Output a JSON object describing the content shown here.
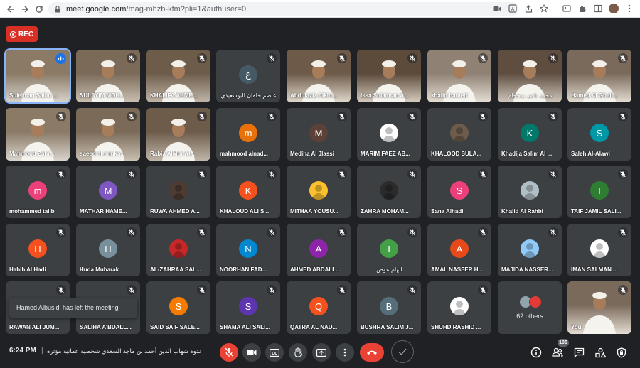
{
  "browser": {
    "url_host": "meet.google.com",
    "url_path": "/mag-mhzb-kfm?pli=1&authuser=0"
  },
  "rec_label": "REC",
  "tiles": [
    {
      "name": "Suleiman Salim ...",
      "kind": "video",
      "status": "speaking"
    },
    {
      "name": "SULAYIM MOH...",
      "kind": "video",
      "status": "muted"
    },
    {
      "name": "KHALIFA AHME...",
      "kind": "video",
      "status": "muted"
    },
    {
      "name": "عاصم خلفان البوسعيدي",
      "kind": "avatar",
      "initial": "ع",
      "color": "#455a64",
      "status": "muted"
    },
    {
      "name": "Abdulaziz Alkin...",
      "kind": "video",
      "status": "muted"
    },
    {
      "name": "Issa Sulaiman A...",
      "kind": "video",
      "status": "muted"
    },
    {
      "name": "khalid hamed",
      "kind": "video",
      "status": "muted"
    },
    {
      "name": "محمد ناصر بوحجام",
      "kind": "video",
      "status": "muted"
    },
    {
      "name": "Hamed Al Gheil...",
      "kind": "video",
      "status": "muted"
    },
    {
      "name": "Mahmood Zahr...",
      "kind": "video",
      "status": "muted"
    },
    {
      "name": "saeed al-shuka...",
      "kind": "video",
      "status": "muted"
    },
    {
      "name": "Rabia AlMur Al...",
      "kind": "video",
      "status": "muted"
    },
    {
      "name": "mahmood alnad...",
      "kind": "avatar",
      "initial": "m",
      "color": "#e8710a",
      "status": "muted"
    },
    {
      "name": "Mediha Al Jlassi",
      "kind": "avatar",
      "initial": "M",
      "color": "#5d4037",
      "status": "muted"
    },
    {
      "name": "MARIM FAEZ AB...",
      "kind": "photo",
      "color": "#ffffff",
      "status": "muted"
    },
    {
      "name": "KHALOOD SULA...",
      "kind": "photo",
      "color": "#6d5b4b",
      "status": "muted"
    },
    {
      "name": "Khadija Salim Al ...",
      "kind": "avatar",
      "initial": "K",
      "color": "#00796b",
      "status": "muted"
    },
    {
      "name": "Saleh Al-Alawi",
      "kind": "avatar",
      "initial": "S",
      "color": "#0097a7",
      "status": "muted"
    },
    {
      "name": "mohammed talib",
      "kind": "avatar",
      "initial": "m",
      "color": "#ec407a",
      "status": "muted"
    },
    {
      "name": "MATHAR HAME...",
      "kind": "avatar",
      "initial": "M",
      "color": "#7e57c2",
      "status": "muted"
    },
    {
      "name": "RUWA AHMED A...",
      "kind": "photo",
      "color": "#4e3b32",
      "status": "muted"
    },
    {
      "name": "KHALOUD ALI S...",
      "kind": "avatar",
      "initial": "K",
      "color": "#f4511e",
      "status": "muted"
    },
    {
      "name": "MITHAA YOUSU...",
      "kind": "photo",
      "color": "#fbc02d",
      "status": "muted"
    },
    {
      "name": "ZAHRA MOHAM...",
      "kind": "photo",
      "color": "#2b2b2b",
      "status": "muted"
    },
    {
      "name": "Sana Alhadi",
      "kind": "avatar",
      "initial": "S",
      "color": "#ec407a",
      "status": "muted"
    },
    {
      "name": "Khalid Al Rahbi",
      "kind": "photo",
      "color": "#b0bec5",
      "status": "muted"
    },
    {
      "name": "TAIF JAMIL SALI...",
      "kind": "avatar",
      "initial": "T",
      "color": "#2e7d32",
      "status": "muted"
    },
    {
      "name": "Habib Al Hadi",
      "kind": "avatar",
      "initial": "H",
      "color": "#f4511e",
      "status": "muted"
    },
    {
      "name": "Huda Mubarak",
      "kind": "avatar",
      "initial": "H",
      "color": "#78909c",
      "status": "muted"
    },
    {
      "name": "AL-ZAHRAA SAL...",
      "kind": "photo",
      "color": "#c62828",
      "status": "muted"
    },
    {
      "name": "NOORHAN FAD...",
      "kind": "avatar",
      "initial": "N",
      "color": "#0288d1",
      "status": "muted"
    },
    {
      "name": "AHMED ABDALL...",
      "kind": "avatar",
      "initial": "A",
      "color": "#8e24aa",
      "status": "muted"
    },
    {
      "name": "الهام عوض",
      "kind": "avatar",
      "initial": "I",
      "color": "#43a047",
      "status": "muted"
    },
    {
      "name": "AMAL NASSER H...",
      "kind": "avatar",
      "initial": "A",
      "color": "#e64a19",
      "status": "muted"
    },
    {
      "name": "MAJIDA NASSER...",
      "kind": "photo",
      "color": "#90caf9",
      "status": "muted"
    },
    {
      "name": "IMAN SALMAN ...",
      "kind": "photo",
      "color": "#ffffff",
      "status": "muted"
    },
    {
      "name": "RAWAN ALI JUM...",
      "kind": "avatar",
      "initial": "",
      "color": "#3c4043",
      "status": "muted"
    },
    {
      "name": "SALIHA A'BDALL...",
      "kind": "avatar",
      "initial": "",
      "color": "#3c4043",
      "status": "muted"
    },
    {
      "name": "SAID SAIF SALE...",
      "kind": "avatar",
      "initial": "S",
      "color": "#f57c00",
      "status": "muted"
    },
    {
      "name": "SHAMA ALI SALI...",
      "kind": "avatar",
      "initial": "S",
      "color": "#5e35b1",
      "status": "muted"
    },
    {
      "name": "QATRA AL NAD...",
      "kind": "avatar",
      "initial": "Q",
      "color": "#f4511e",
      "status": "muted"
    },
    {
      "name": "BUSHRA SALIM J...",
      "kind": "avatar",
      "initial": "B",
      "color": "#546e7a",
      "status": "muted"
    },
    {
      "name": "SHUHD RASHID ...",
      "kind": "photo",
      "color": "#ffffff",
      "status": "muted"
    },
    {
      "name": "62 others",
      "kind": "others",
      "status": "none"
    },
    {
      "name": "You",
      "kind": "video",
      "status": "muted"
    }
  ],
  "toast": "Hamed Albusidi has left the meeting",
  "bottom": {
    "time": "6:24 PM",
    "separator": "|",
    "meeting_title": "ندوة شهاب الدين أحمد بن ماجد السعدي شخصية عمانية مؤثرة",
    "participants_count": "106"
  }
}
